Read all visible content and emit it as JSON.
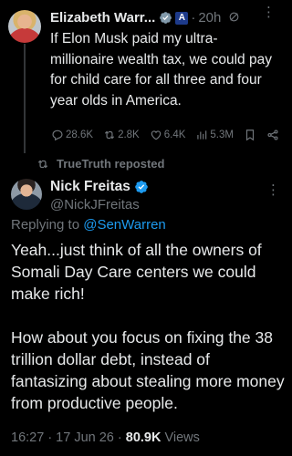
{
  "tweet1": {
    "author_name": "Elizabeth Warr...",
    "flag_badge": "A",
    "separator": "·",
    "time": "20h",
    "text": "If Elon Musk paid my ultra-millionaire wealth tax, we could pay for child care for all three and four year olds in America.",
    "actions": {
      "replies": "28.6K",
      "reposts": "2.8K",
      "likes": "6.4K",
      "views": "5.3M"
    }
  },
  "repost_line": {
    "label": "TrueTruth reposted"
  },
  "tweet2": {
    "author_name": "Nick Freitas",
    "handle": "@NickJFreitas",
    "replying_prefix": "Replying to ",
    "replying_to": "@SenWarren",
    "paragraphs": [
      "Yeah...just think of all the owners of Somali Day Care centers we could make rich!",
      "How about you focus on fixing the 38 trillion dollar debt, instead of fantasizing about stealing more money from productive people."
    ],
    "timestamp": "16:27 · 17 Jun 26 · ",
    "views_count": "80.9K",
    "views_label": " Views"
  },
  "colors": {
    "background": "#000000",
    "text_primary": "#e7e9ea",
    "text_secondary": "#71767b",
    "accent_link": "#1d9bf0",
    "verified_blue": "#1d9bf0",
    "verified_grey": "#829aab"
  },
  "icons": [
    "verified-grey-icon",
    "flag-badge-icon",
    "ghost-icon",
    "more-icon",
    "reply-icon",
    "repost-icon",
    "like-icon",
    "views-icon",
    "bookmark-icon",
    "share-icon",
    "verified-blue-icon"
  ]
}
